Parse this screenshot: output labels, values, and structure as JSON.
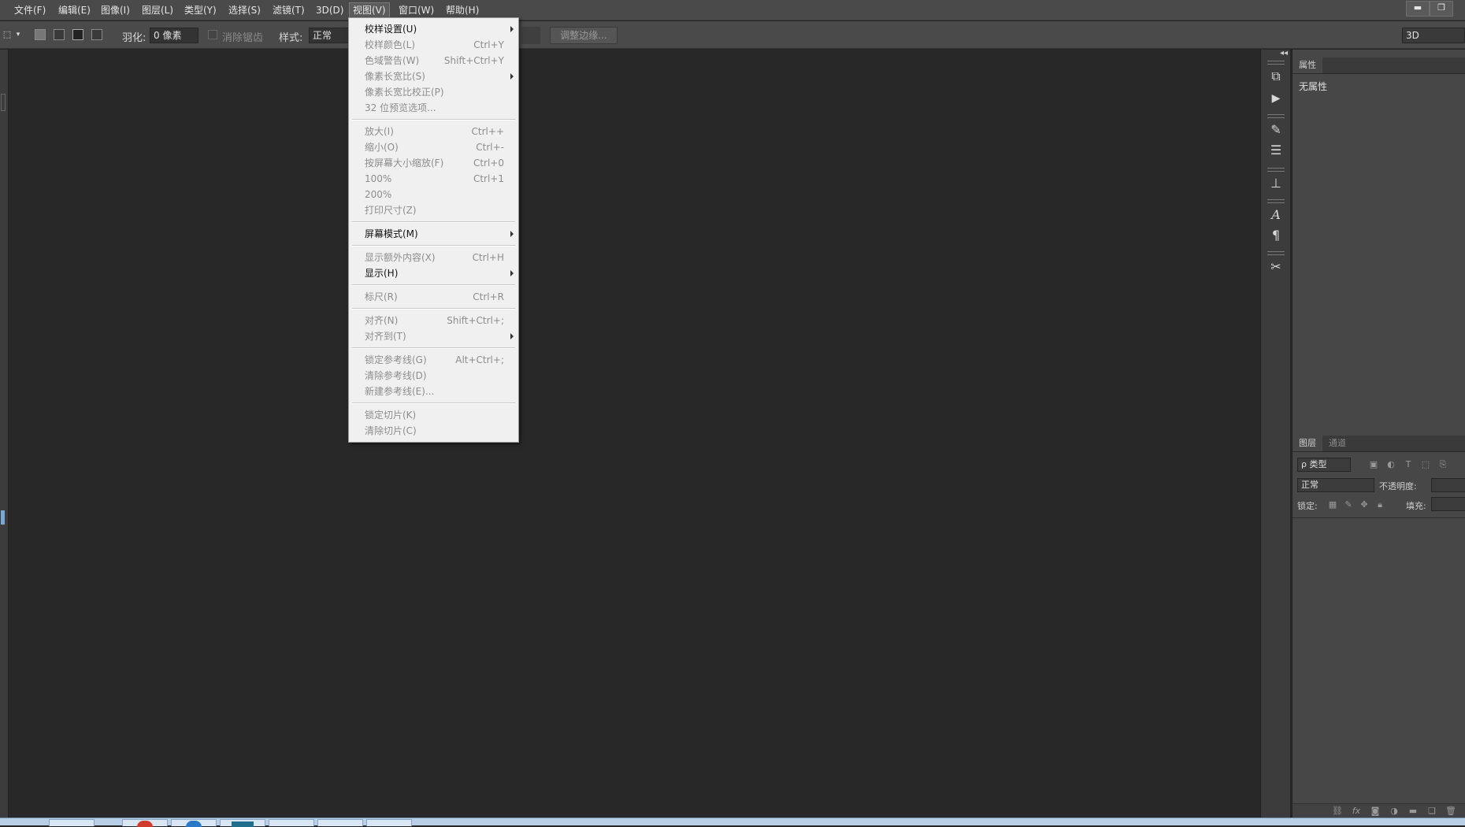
{
  "menubar": {
    "items": [
      "文件(F)",
      "编辑(E)",
      "图像(I)",
      "图层(L)",
      "类型(Y)",
      "选择(S)",
      "滤镜(T)",
      "3D(D)",
      "视图(V)",
      "窗口(W)",
      "帮助(H)"
    ],
    "active": "视图(V)"
  },
  "window_controls": {
    "minimize": "▬",
    "restore": "❐"
  },
  "options_bar": {
    "feather_label": "羽化:",
    "feather_value": "0 像素",
    "antialias_label": "消除锯齿",
    "style_label": "样式:",
    "style_value": "正常",
    "refine_edge_button": "调整边缘...",
    "workspace": "3D"
  },
  "view_menu": {
    "items": [
      {
        "label": "校样设置(U)",
        "shortcut": "",
        "enabled": true,
        "submenu": true
      },
      {
        "label": "校样颜色(L)",
        "shortcut": "Ctrl+Y",
        "enabled": false,
        "submenu": false
      },
      {
        "label": "色域警告(W)",
        "shortcut": "Shift+Ctrl+Y",
        "enabled": false,
        "submenu": false
      },
      {
        "label": "像素长宽比(S)",
        "shortcut": "",
        "enabled": false,
        "submenu": true
      },
      {
        "label": "像素长宽比校正(P)",
        "shortcut": "",
        "enabled": false,
        "submenu": false
      },
      {
        "label": "32 位预览选项...",
        "shortcut": "",
        "enabled": false,
        "submenu": false
      },
      {
        "label": "放大(I)",
        "shortcut": "Ctrl++",
        "enabled": false,
        "submenu": false
      },
      {
        "label": "缩小(O)",
        "shortcut": "Ctrl+-",
        "enabled": false,
        "submenu": false
      },
      {
        "label": "按屏幕大小缩放(F)",
        "shortcut": "Ctrl+0",
        "enabled": false,
        "submenu": false
      },
      {
        "label": "100%",
        "shortcut": "Ctrl+1",
        "enabled": false,
        "submenu": false
      },
      {
        "label": "200%",
        "shortcut": "",
        "enabled": false,
        "submenu": false
      },
      {
        "label": "打印尺寸(Z)",
        "shortcut": "",
        "enabled": false,
        "submenu": false
      },
      {
        "label": "屏幕模式(M)",
        "shortcut": "",
        "enabled": true,
        "submenu": true
      },
      {
        "label": "显示额外内容(X)",
        "shortcut": "Ctrl+H",
        "enabled": false,
        "submenu": false
      },
      {
        "label": "显示(H)",
        "shortcut": "",
        "enabled": true,
        "submenu": true
      },
      {
        "label": "标尺(R)",
        "shortcut": "Ctrl+R",
        "enabled": false,
        "submenu": false
      },
      {
        "label": "对齐(N)",
        "shortcut": "Shift+Ctrl+;",
        "enabled": false,
        "submenu": false
      },
      {
        "label": "对齐到(T)",
        "shortcut": "",
        "enabled": false,
        "submenu": true
      },
      {
        "label": "锁定参考线(G)",
        "shortcut": "Alt+Ctrl+;",
        "enabled": false,
        "submenu": false
      },
      {
        "label": "清除参考线(D)",
        "shortcut": "",
        "enabled": false,
        "submenu": false
      },
      {
        "label": "新建参考线(E)...",
        "shortcut": "",
        "enabled": false,
        "submenu": false
      },
      {
        "label": "锁定切片(K)",
        "shortcut": "",
        "enabled": false,
        "submenu": false
      },
      {
        "label": "清除切片(C)",
        "shortcut": "",
        "enabled": false,
        "submenu": false
      }
    ]
  },
  "properties_panel": {
    "tab": "属性",
    "content": "无属性"
  },
  "layers_panel": {
    "tabs": [
      "图层",
      "通道"
    ],
    "filter_label": "ρ 类型",
    "blend_mode": "正常",
    "opacity_label": "不透明度:",
    "lock_label": "锁定:",
    "fill_label": "填充:"
  }
}
